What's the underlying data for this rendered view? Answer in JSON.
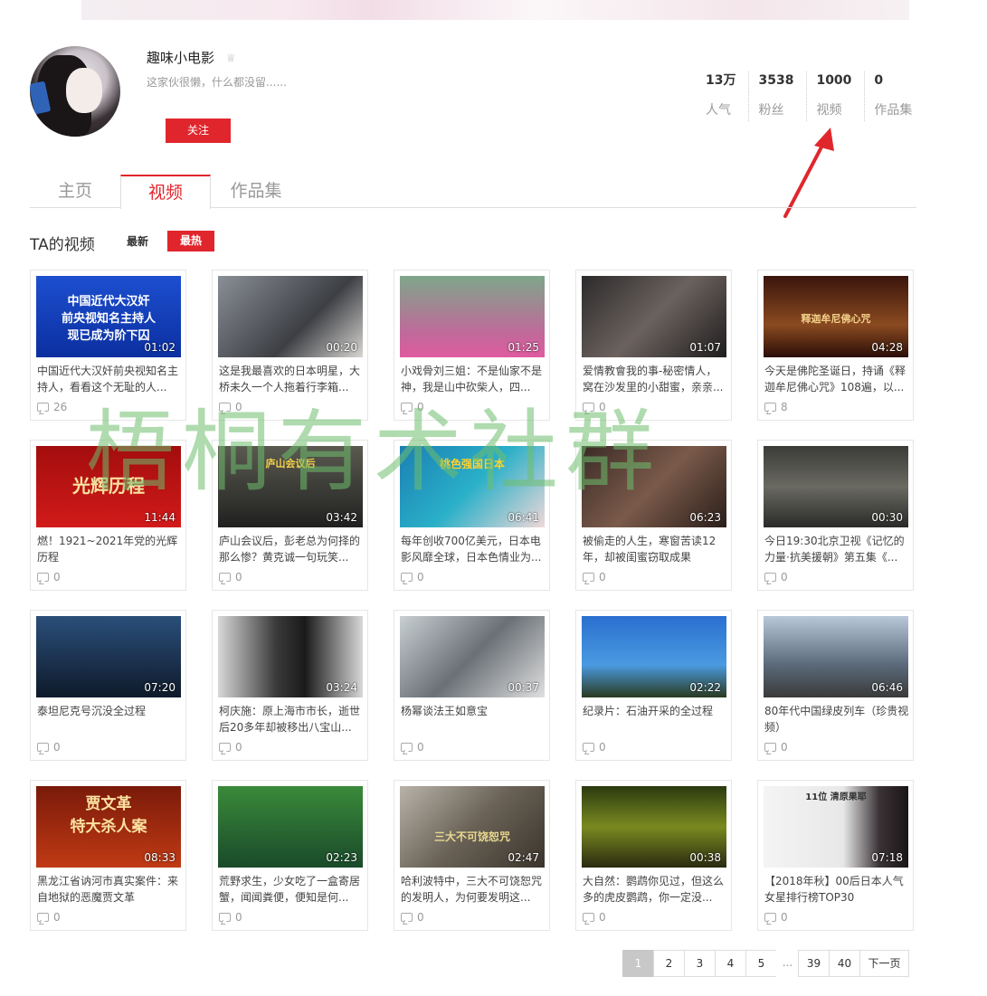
{
  "profile": {
    "name": "趣味小电影",
    "bio": "这家伙很懒，什么都没留......",
    "follow_label": "关注"
  },
  "stats": [
    {
      "value": "13万",
      "label": "人气"
    },
    {
      "value": "3538",
      "label": "粉丝"
    },
    {
      "value": "1000",
      "label": "视频"
    },
    {
      "value": "0",
      "label": "作品集"
    }
  ],
  "tabs": [
    {
      "label": "主页",
      "active": false
    },
    {
      "label": "视频",
      "active": true
    },
    {
      "label": "作品集",
      "active": false
    }
  ],
  "section": {
    "title": "TA的视频",
    "sort_new": "最新",
    "sort_hot": "最热"
  },
  "videos": [
    {
      "duration": "01:02",
      "title": "中国近代大汉奸前央视知名主持人，看看这个无耻的人...",
      "comments": "26",
      "thumb_text": "中国近代大汉奸\n前央视知名主持人\n现已成为阶下囚"
    },
    {
      "duration": "00:20",
      "title": "这是我最喜欢的日本明星，大桥未久一个人拖着行李箱...",
      "comments": "0",
      "thumb_text": ""
    },
    {
      "duration": "01:25",
      "title": "小戏骨刘三姐：不是仙家不是神，我是山中砍柴人，四...",
      "comments": "0",
      "thumb_text": ""
    },
    {
      "duration": "01:07",
      "title": "爱情教會我的事-秘密情人，窝在沙发里的小甜蜜，亲亲...",
      "comments": "0",
      "thumb_text": ""
    },
    {
      "duration": "04:28",
      "title": "今天是佛陀圣诞日，持诵《释迦牟尼佛心咒》108遍，以...",
      "comments": "8",
      "thumb_text": "释迦牟尼佛心咒"
    },
    {
      "duration": "11:44",
      "title": "燃！1921~2021年党的光辉历程",
      "comments": "0",
      "thumb_text": "光辉历程"
    },
    {
      "duration": "03:42",
      "title": "庐山会议后，彭老总为何择的那么惨？黄克诚一句玩笑...",
      "comments": "0",
      "thumb_text": "庐山会议后"
    },
    {
      "duration": "06:41",
      "title": "每年创收700亿美元，日本电影风靡全球，日本色情业为...",
      "comments": "0",
      "thumb_text": "桃色强国日本"
    },
    {
      "duration": "06:23",
      "title": "被偷走的人生，寒窗苦读12年，却被闺蜜窃取成果",
      "comments": "0",
      "thumb_text": ""
    },
    {
      "duration": "00:30",
      "title": "今日19:30北京卫视《记忆的力量·抗美援朝》第五集《...",
      "comments": "0",
      "thumb_text": ""
    },
    {
      "duration": "07:20",
      "title": "泰坦尼克号沉没全过程",
      "comments": "0",
      "thumb_text": ""
    },
    {
      "duration": "03:24",
      "title": "柯庆施：原上海市市长，逝世后20多年却被移出八宝山...",
      "comments": "0",
      "thumb_text": ""
    },
    {
      "duration": "00:37",
      "title": "杨幂谈法王如意宝",
      "comments": "0",
      "thumb_text": ""
    },
    {
      "duration": "02:22",
      "title": "纪录片：石油开采的全过程",
      "comments": "0",
      "thumb_text": ""
    },
    {
      "duration": "06:46",
      "title": "80年代中国绿皮列车（珍贵视频）",
      "comments": "0",
      "thumb_text": ""
    },
    {
      "duration": "08:33",
      "title": "黑龙江省讷河市真实案件：来自地狱的恶魔贾文革",
      "comments": "0",
      "thumb_text": "贾文革\n特大杀人案"
    },
    {
      "duration": "02:23",
      "title": "荒野求生，少女吃了一盒寄居蟹，闻闻粪便，便知是何...",
      "comments": "0",
      "thumb_text": ""
    },
    {
      "duration": "02:47",
      "title": "哈利波特中，三大不可饶恕咒的发明人，为何要发明这...",
      "comments": "0",
      "thumb_text": "三大不可饶恕咒"
    },
    {
      "duration": "00:38",
      "title": "大自然：鹦鹉你见过，但这么多的虎皮鹦鹉，你一定没...",
      "comments": "0",
      "thumb_text": ""
    },
    {
      "duration": "07:18",
      "title": "【2018年秋】00后日本人气女星排行榜TOP30",
      "comments": "0",
      "thumb_text": "11位 清原果耶"
    }
  ],
  "pagination": [
    "1",
    "2",
    "3",
    "4",
    "5",
    "...",
    "39",
    "40",
    "下一页"
  ],
  "watermark": "梧桐有术社群",
  "colors": {
    "accent": "#e0262c"
  }
}
